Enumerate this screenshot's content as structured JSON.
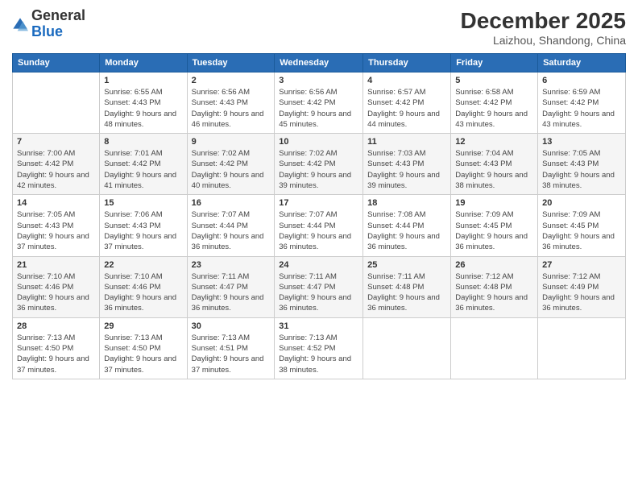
{
  "header": {
    "logo_general": "General",
    "logo_blue": "Blue",
    "month_title": "December 2025",
    "location": "Laizhou, Shandong, China"
  },
  "days_of_week": [
    "Sunday",
    "Monday",
    "Tuesday",
    "Wednesday",
    "Thursday",
    "Friday",
    "Saturday"
  ],
  "weeks": [
    [
      {
        "day": "",
        "sunrise": "",
        "sunset": "",
        "daylight": ""
      },
      {
        "day": "1",
        "sunrise": "Sunrise: 6:55 AM",
        "sunset": "Sunset: 4:43 PM",
        "daylight": "Daylight: 9 hours and 48 minutes."
      },
      {
        "day": "2",
        "sunrise": "Sunrise: 6:56 AM",
        "sunset": "Sunset: 4:43 PM",
        "daylight": "Daylight: 9 hours and 46 minutes."
      },
      {
        "day": "3",
        "sunrise": "Sunrise: 6:56 AM",
        "sunset": "Sunset: 4:42 PM",
        "daylight": "Daylight: 9 hours and 45 minutes."
      },
      {
        "day": "4",
        "sunrise": "Sunrise: 6:57 AM",
        "sunset": "Sunset: 4:42 PM",
        "daylight": "Daylight: 9 hours and 44 minutes."
      },
      {
        "day": "5",
        "sunrise": "Sunrise: 6:58 AM",
        "sunset": "Sunset: 4:42 PM",
        "daylight": "Daylight: 9 hours and 43 minutes."
      },
      {
        "day": "6",
        "sunrise": "Sunrise: 6:59 AM",
        "sunset": "Sunset: 4:42 PM",
        "daylight": "Daylight: 9 hours and 43 minutes."
      }
    ],
    [
      {
        "day": "7",
        "sunrise": "Sunrise: 7:00 AM",
        "sunset": "Sunset: 4:42 PM",
        "daylight": "Daylight: 9 hours and 42 minutes."
      },
      {
        "day": "8",
        "sunrise": "Sunrise: 7:01 AM",
        "sunset": "Sunset: 4:42 PM",
        "daylight": "Daylight: 9 hours and 41 minutes."
      },
      {
        "day": "9",
        "sunrise": "Sunrise: 7:02 AM",
        "sunset": "Sunset: 4:42 PM",
        "daylight": "Daylight: 9 hours and 40 minutes."
      },
      {
        "day": "10",
        "sunrise": "Sunrise: 7:02 AM",
        "sunset": "Sunset: 4:42 PM",
        "daylight": "Daylight: 9 hours and 39 minutes."
      },
      {
        "day": "11",
        "sunrise": "Sunrise: 7:03 AM",
        "sunset": "Sunset: 4:43 PM",
        "daylight": "Daylight: 9 hours and 39 minutes."
      },
      {
        "day": "12",
        "sunrise": "Sunrise: 7:04 AM",
        "sunset": "Sunset: 4:43 PM",
        "daylight": "Daylight: 9 hours and 38 minutes."
      },
      {
        "day": "13",
        "sunrise": "Sunrise: 7:05 AM",
        "sunset": "Sunset: 4:43 PM",
        "daylight": "Daylight: 9 hours and 38 minutes."
      }
    ],
    [
      {
        "day": "14",
        "sunrise": "Sunrise: 7:05 AM",
        "sunset": "Sunset: 4:43 PM",
        "daylight": "Daylight: 9 hours and 37 minutes."
      },
      {
        "day": "15",
        "sunrise": "Sunrise: 7:06 AM",
        "sunset": "Sunset: 4:43 PM",
        "daylight": "Daylight: 9 hours and 37 minutes."
      },
      {
        "day": "16",
        "sunrise": "Sunrise: 7:07 AM",
        "sunset": "Sunset: 4:44 PM",
        "daylight": "Daylight: 9 hours and 36 minutes."
      },
      {
        "day": "17",
        "sunrise": "Sunrise: 7:07 AM",
        "sunset": "Sunset: 4:44 PM",
        "daylight": "Daylight: 9 hours and 36 minutes."
      },
      {
        "day": "18",
        "sunrise": "Sunrise: 7:08 AM",
        "sunset": "Sunset: 4:44 PM",
        "daylight": "Daylight: 9 hours and 36 minutes."
      },
      {
        "day": "19",
        "sunrise": "Sunrise: 7:09 AM",
        "sunset": "Sunset: 4:45 PM",
        "daylight": "Daylight: 9 hours and 36 minutes."
      },
      {
        "day": "20",
        "sunrise": "Sunrise: 7:09 AM",
        "sunset": "Sunset: 4:45 PM",
        "daylight": "Daylight: 9 hours and 36 minutes."
      }
    ],
    [
      {
        "day": "21",
        "sunrise": "Sunrise: 7:10 AM",
        "sunset": "Sunset: 4:46 PM",
        "daylight": "Daylight: 9 hours and 36 minutes."
      },
      {
        "day": "22",
        "sunrise": "Sunrise: 7:10 AM",
        "sunset": "Sunset: 4:46 PM",
        "daylight": "Daylight: 9 hours and 36 minutes."
      },
      {
        "day": "23",
        "sunrise": "Sunrise: 7:11 AM",
        "sunset": "Sunset: 4:47 PM",
        "daylight": "Daylight: 9 hours and 36 minutes."
      },
      {
        "day": "24",
        "sunrise": "Sunrise: 7:11 AM",
        "sunset": "Sunset: 4:47 PM",
        "daylight": "Daylight: 9 hours and 36 minutes."
      },
      {
        "day": "25",
        "sunrise": "Sunrise: 7:11 AM",
        "sunset": "Sunset: 4:48 PM",
        "daylight": "Daylight: 9 hours and 36 minutes."
      },
      {
        "day": "26",
        "sunrise": "Sunrise: 7:12 AM",
        "sunset": "Sunset: 4:48 PM",
        "daylight": "Daylight: 9 hours and 36 minutes."
      },
      {
        "day": "27",
        "sunrise": "Sunrise: 7:12 AM",
        "sunset": "Sunset: 4:49 PM",
        "daylight": "Daylight: 9 hours and 36 minutes."
      }
    ],
    [
      {
        "day": "28",
        "sunrise": "Sunrise: 7:13 AM",
        "sunset": "Sunset: 4:50 PM",
        "daylight": "Daylight: 9 hours and 37 minutes."
      },
      {
        "day": "29",
        "sunrise": "Sunrise: 7:13 AM",
        "sunset": "Sunset: 4:50 PM",
        "daylight": "Daylight: 9 hours and 37 minutes."
      },
      {
        "day": "30",
        "sunrise": "Sunrise: 7:13 AM",
        "sunset": "Sunset: 4:51 PM",
        "daylight": "Daylight: 9 hours and 37 minutes."
      },
      {
        "day": "31",
        "sunrise": "Sunrise: 7:13 AM",
        "sunset": "Sunset: 4:52 PM",
        "daylight": "Daylight: 9 hours and 38 minutes."
      },
      {
        "day": "",
        "sunrise": "",
        "sunset": "",
        "daylight": ""
      },
      {
        "day": "",
        "sunrise": "",
        "sunset": "",
        "daylight": ""
      },
      {
        "day": "",
        "sunrise": "",
        "sunset": "",
        "daylight": ""
      }
    ]
  ]
}
